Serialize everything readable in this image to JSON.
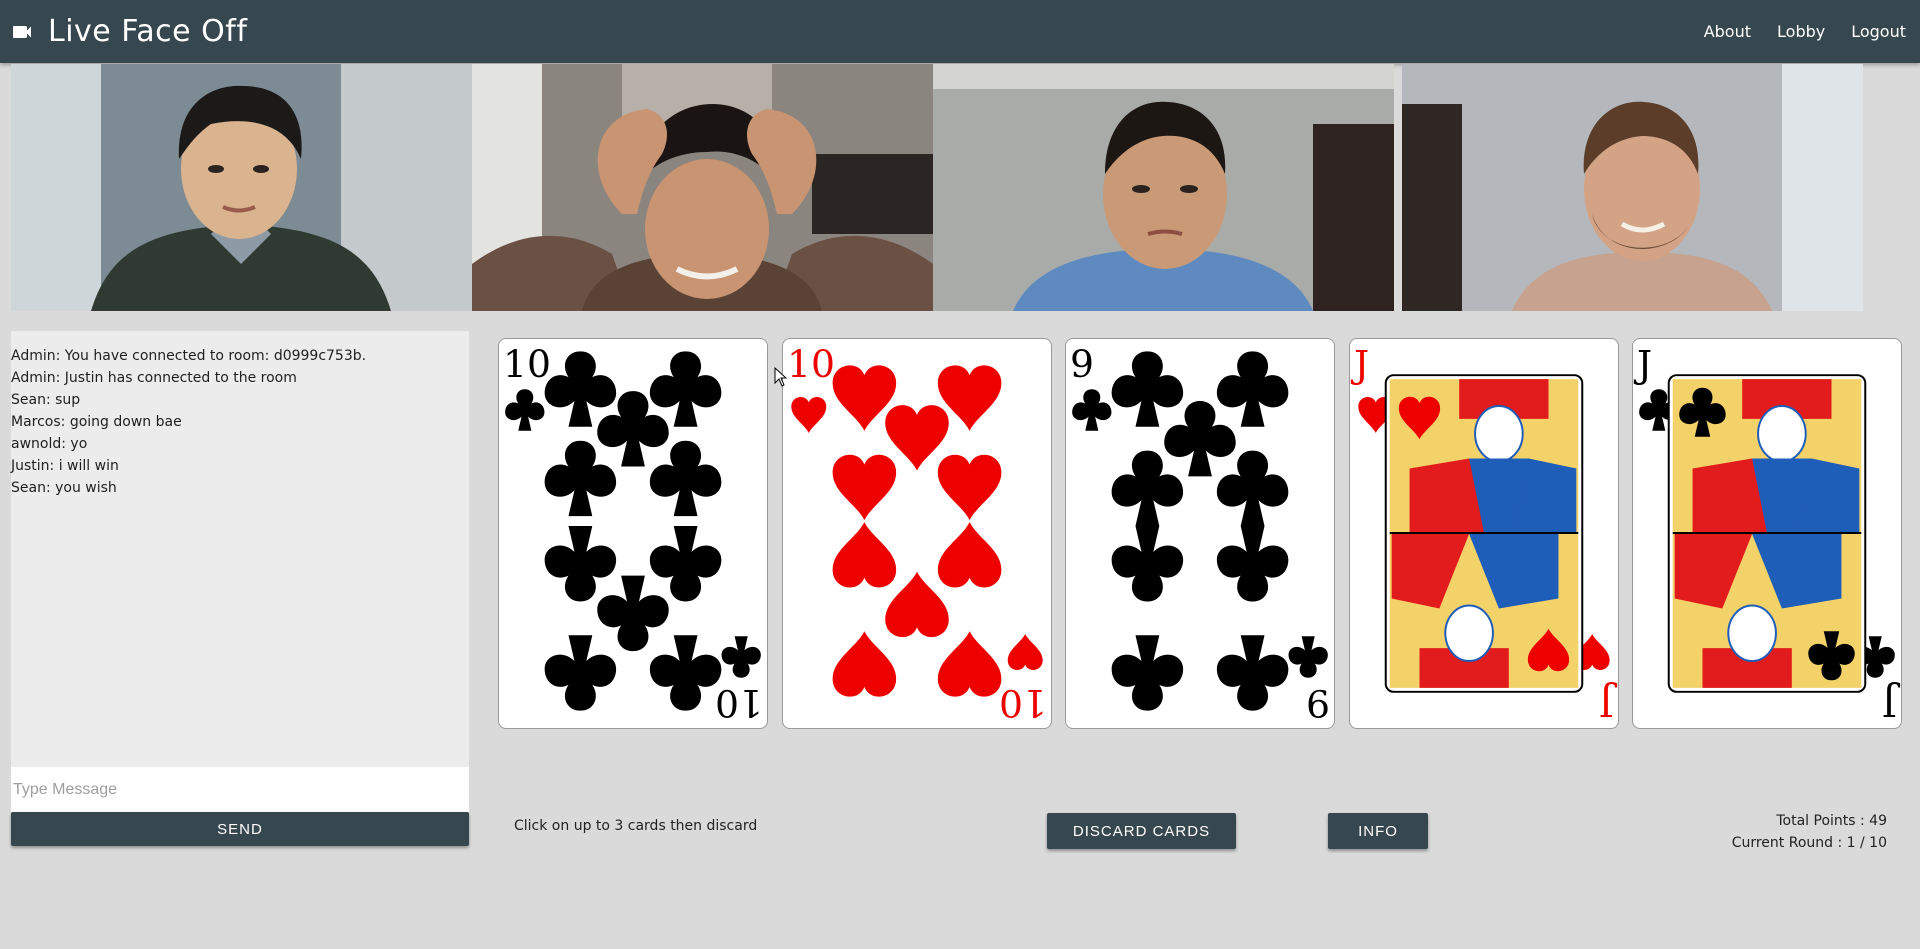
{
  "navbar": {
    "title": "Live Face Off",
    "brand_icon": "videocam-icon",
    "links": [
      "About",
      "Lobby",
      "Logout"
    ]
  },
  "video_feeds": [
    {
      "name": "player-video-1",
      "bg": "#6f7e88"
    },
    {
      "name": "player-video-2",
      "bg": "#7b7470"
    },
    {
      "name": "player-video-3",
      "bg": "#a6a8a6"
    },
    {
      "name": "player-video-4",
      "bg": "#b3b7bb"
    }
  ],
  "chat": {
    "messages": [
      "Admin: You have connected to room: d0999c753b.",
      "Admin: Justin has connected to the room",
      "Sean: sup",
      "Marcos: going down bae",
      "awnold: yo",
      "Justin: i will win",
      "Sean: you wish"
    ],
    "placeholder": "Type Message",
    "send_label": "Send"
  },
  "hand": [
    {
      "rank": "10",
      "suit": "clubs",
      "color": "#000000"
    },
    {
      "rank": "10",
      "suit": "hearts",
      "color": "#ee0000"
    },
    {
      "rank": "9",
      "suit": "clubs",
      "color": "#000000"
    },
    {
      "rank": "J",
      "suit": "hearts",
      "color": "#ee0000"
    },
    {
      "rank": "J",
      "suit": "clubs",
      "color": "#000000"
    }
  ],
  "controls": {
    "instruction": "Click on up to 3 cards then discard",
    "discard_label": "Discard Cards",
    "info_label": "Info"
  },
  "stats": {
    "total_points": "Total Points : 49",
    "current_round": "Current Round : 1 / 10"
  }
}
